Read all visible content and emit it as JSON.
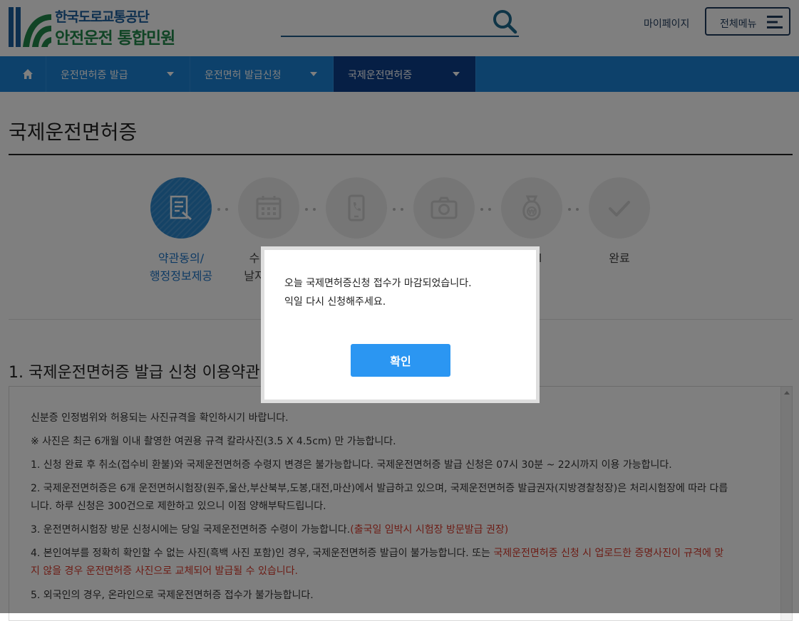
{
  "header": {
    "logo_line1": "한국도로교통공단",
    "logo_line2": "안전운전 통합민원",
    "search_icon": "search-icon",
    "mypage_label": "마이페이지",
    "allmenu_label": "전체메뉴",
    "allmenu_icon": "hamburger-icon"
  },
  "nav": {
    "home_icon": "home-icon",
    "items": [
      {
        "label": "운전면허증 발급"
      },
      {
        "label": "운전면허 발급신청"
      },
      {
        "label": "국제운전면허증"
      }
    ],
    "active_index": 2
  },
  "main": {
    "page_title": "국제운전면허증",
    "steps": [
      {
        "icon": "document-pen-icon",
        "label_line1": "약관동의/",
        "label_line2": "행정정보제공",
        "active": true
      },
      {
        "icon": "calendar-icon",
        "label_line1": "수",
        "label_line2": "날지",
        "active": false
      },
      {
        "icon": "phone-icon",
        "label_line1": "",
        "label_line2": "",
        "active": false
      },
      {
        "icon": "camera-icon",
        "label_line1": "",
        "label_line2": "",
        "active": false
      },
      {
        "icon": "money-bag-icon",
        "label_line1": "l",
        "label_line2": "",
        "active": false
      },
      {
        "icon": "check-icon",
        "label_line1": "완료",
        "label_line2": "",
        "active": false
      }
    ],
    "section_title": "1. 국제운전면허증 발급 신청 이용약관",
    "terms": {
      "intro": "신분증 인정범위와 허용되는 사진규격을 확인하시기 바랍니다.",
      "photo_note": "※ 사진은 최근 6개월 이내 촬영한 여권용 규격 칼라사진(3.5 X 4.5cm) 만 가능합니다.",
      "item1": "1. 신청 완료 후 취소(접수비 환불)와 국제운전면허증 수령지 변경은 불가능합니다. 국제운전면허증 발급 신청은 07시 30분 ~ 22시까지 이용 가능합니다.",
      "item2_line1": "2. 국제운전면허증은 6개 운전면허시험장(원주,울산,부산북부,도봉,대전,마산)에서 발급하고 있으며, 국제운전면허증 발급권자(지방경찰청장)은 처리시험장에 따라 다릅",
      "item2_line2": "니다. 하루 신청은 300건으로 제한하고 있으니 이점 양해부탁드립니다.",
      "item3_main": "3. 운전면허시험장 방문 신청시에는 당일 국제운전면허증 수령이 가능합니다.",
      "item3_note": "(출국일 임박시 시험장 방문발급 권장)",
      "item4_main": "4. 본인여부를 정확히 확인할 수 없는 사진(흑백 사진 포함)인 경우, 국제운전면허증 발급이 불가능합니다. 또는 ",
      "item4_red_line1": "국제운전면허증 신청 시 업로드한 증명사진이 규격에 맞",
      "item4_red_line2": "지 않을 경우 운전면허증 사진으로 교체되어 발급될 수 있습니다.",
      "item5": "5. 외국인의 경우, 온라인으로 국제운전면허증 접수가 불가능합니다."
    }
  },
  "modal": {
    "message_line1": "오늘 국제면허증신청 접수가 마감되었습니다.",
    "message_line2": "익일 다시 신청해주세요.",
    "confirm_label": "확인"
  },
  "colors": {
    "nav_bg": "#1a82d6",
    "nav_active_bg": "#0d3f8a",
    "step_active": "#2a86cc",
    "accent_red": "#d8392b",
    "confirm_button": "#2b96f2",
    "brand_blue": "#1a5f9e",
    "brand_green": "#20894a"
  }
}
